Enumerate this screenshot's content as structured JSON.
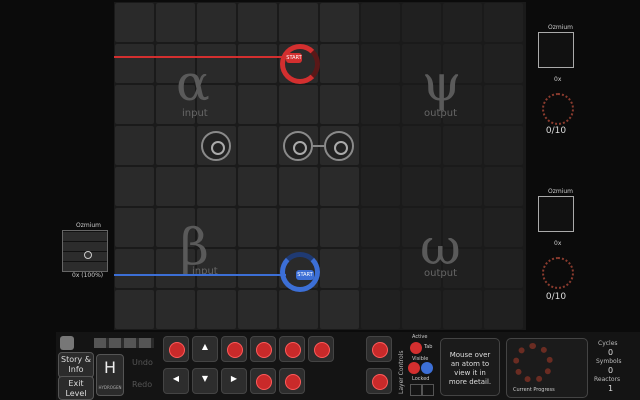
{
  "board": {
    "regions": [
      {
        "glyph": "α",
        "label": "input"
      },
      {
        "glyph": "ψ",
        "label": "output"
      },
      {
        "glyph": "β",
        "label": "input"
      },
      {
        "glyph": "ω",
        "label": "output"
      }
    ],
    "waldo_red_label": "START",
    "waldo_blue_label": "START"
  },
  "left_preview": {
    "title": "Ozmium",
    "caption": "0x (100%)"
  },
  "outputs": [
    {
      "title": "Ozmium",
      "caption": "0x",
      "count": "0/10"
    },
    {
      "title": "Ozmium",
      "caption": "0x",
      "count": "0/10"
    }
  ],
  "controls": {
    "story_label": "Story & Info",
    "exit_label": "Exit Level",
    "element_label": "H",
    "element_sub": "HYDROGEN",
    "undo_label": "Undo",
    "redo_label": "Redo",
    "layer_controls_label": "Layer Controls",
    "active_label": "Active",
    "tab_label": "Tab",
    "visible_label": "Visible",
    "locked_label": "Locked",
    "hint_text": "Mouse over an atom to view it in more detail.",
    "progress_label": "Current Progress",
    "cycles_label": "Cycles",
    "cycles_value": "0",
    "symbols_label": "Symbols",
    "symbols_value": "0",
    "reactors_label": "Reactors",
    "reactors_value": "1"
  },
  "colors": {
    "red": "#d32f2f",
    "blue": "#3c6fd6",
    "board_cell": "#2a2a2a",
    "background": "#0b0b0b"
  }
}
